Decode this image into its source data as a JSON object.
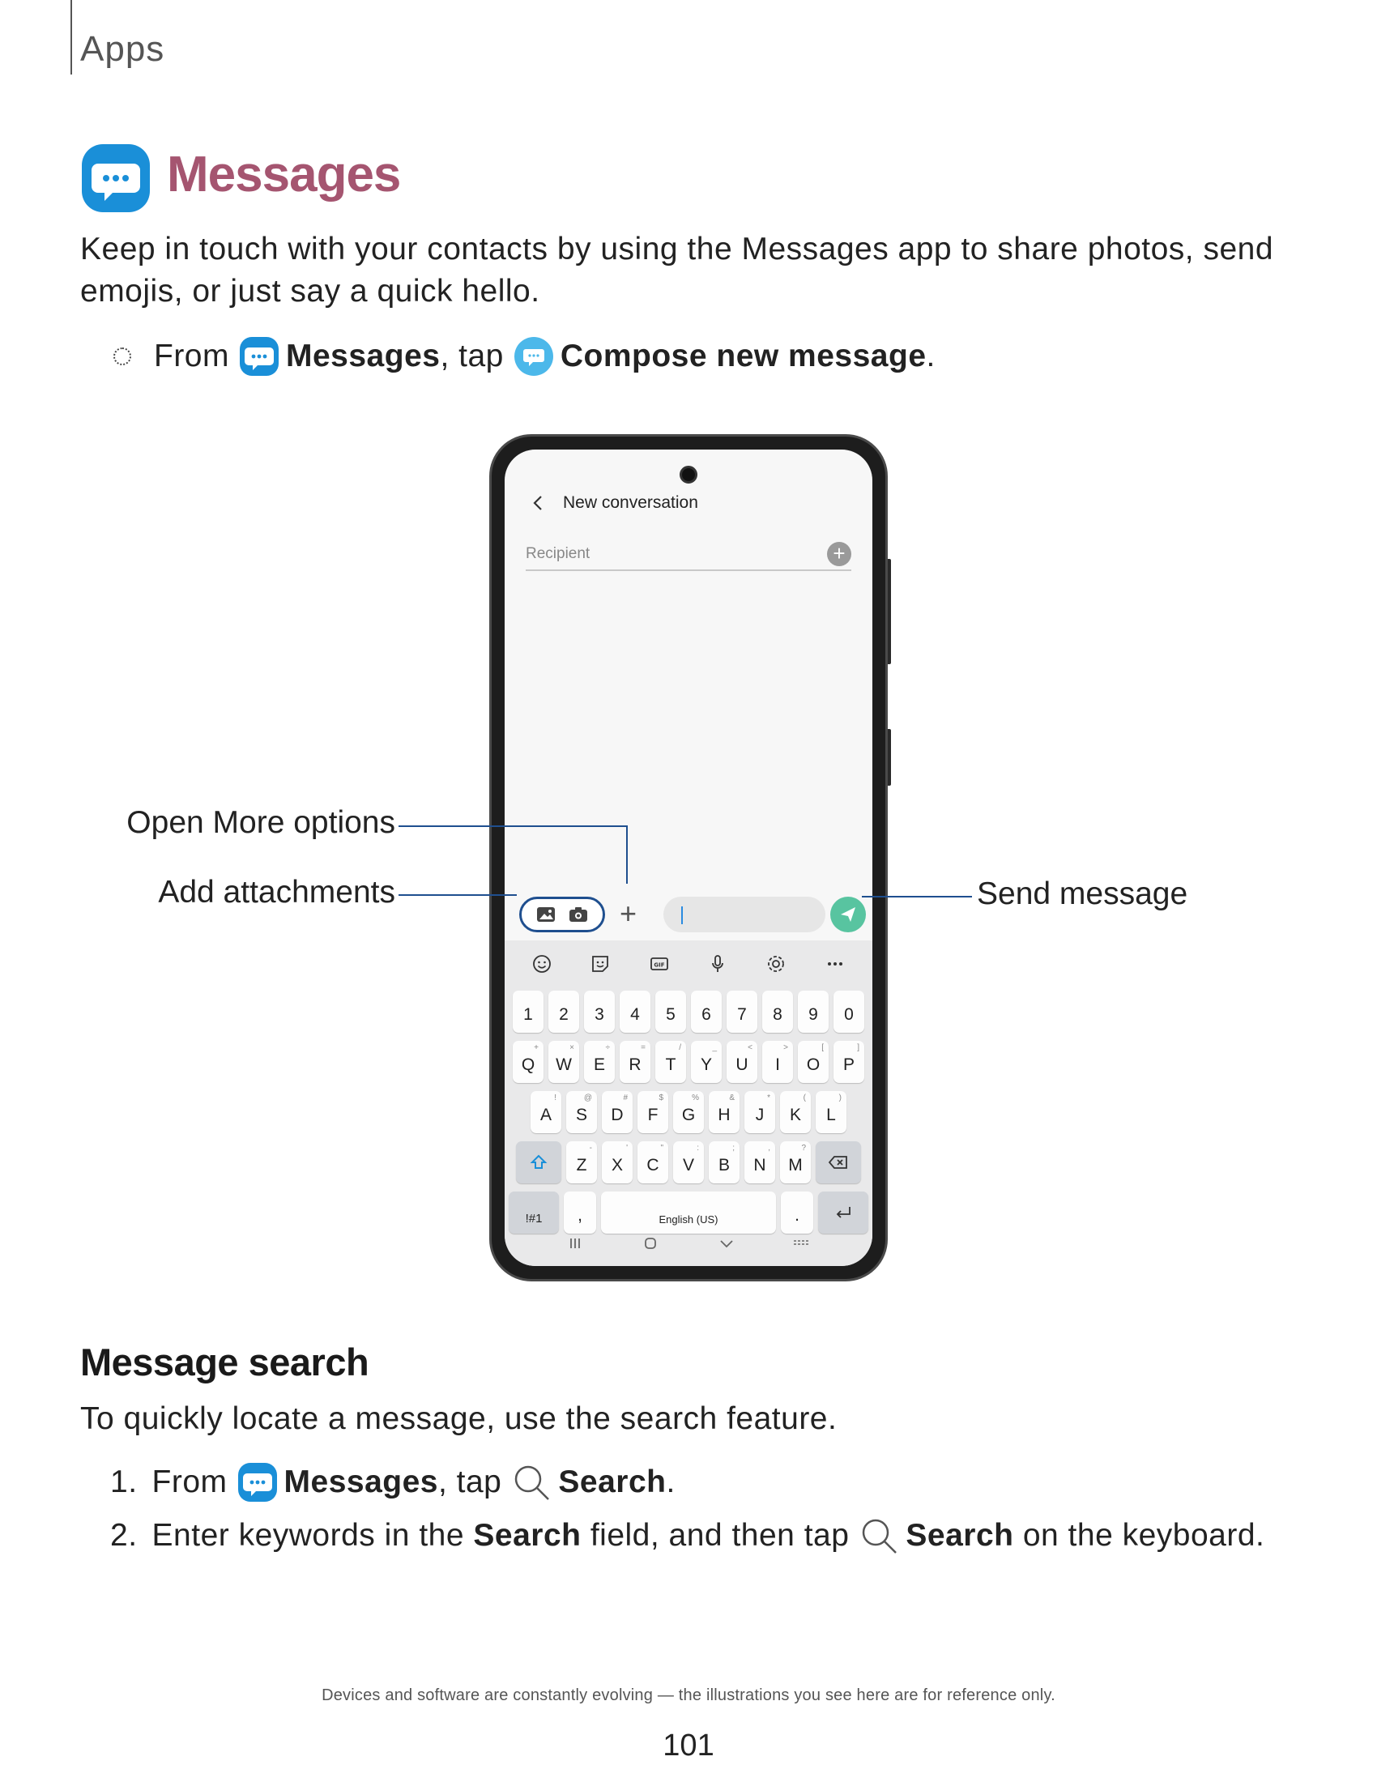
{
  "header": {
    "section_label": "Apps"
  },
  "title": "Messages",
  "intro": "Keep in touch with your contacts by using the Messages app to share photos, send emojis, or just say a quick hello.",
  "bullet": {
    "from": "From",
    "app_name": "Messages",
    "tap": ", tap",
    "action": "Compose new message",
    "end": "."
  },
  "phone": {
    "conversation_title": "New conversation",
    "recipient_placeholder": "Recipient",
    "keyboard": {
      "number_row": [
        "1",
        "2",
        "3",
        "4",
        "5",
        "6",
        "7",
        "8",
        "9",
        "0"
      ],
      "row1": [
        [
          "Q",
          "+"
        ],
        [
          "W",
          "×"
        ],
        [
          "E",
          "÷"
        ],
        [
          "R",
          "="
        ],
        [
          "T",
          "/"
        ],
        [
          "Y",
          "_"
        ],
        [
          "U",
          "<"
        ],
        [
          "I",
          ">"
        ],
        [
          "O",
          "["
        ],
        [
          "P",
          "]"
        ]
      ],
      "row2": [
        [
          "A",
          "!"
        ],
        [
          "S",
          "@"
        ],
        [
          "D",
          "#"
        ],
        [
          "F",
          "$"
        ],
        [
          "G",
          "%"
        ],
        [
          "H",
          "&"
        ],
        [
          "J",
          "*"
        ],
        [
          "K",
          "("
        ],
        [
          "L",
          ")"
        ]
      ],
      "row3": [
        [
          "Z",
          "-"
        ],
        [
          "X",
          "'"
        ],
        [
          "C",
          "\""
        ],
        [
          "V",
          ":"
        ],
        [
          "B",
          ";"
        ],
        [
          "N",
          ","
        ],
        [
          "M",
          "?"
        ]
      ],
      "symbols_key": "!#1",
      "comma_key": ",",
      "space_label": "English (US)",
      "period_key": ".",
      "gif_label": "GIF"
    }
  },
  "callouts": {
    "more_options": "Open More options",
    "attachments": "Add attachments",
    "send": "Send message"
  },
  "search_section": {
    "heading": "Message search",
    "intro": "To quickly locate a message, use the search feature.",
    "step1": {
      "num": "1.",
      "from": "From",
      "app_name": "Messages",
      "tap": ", tap",
      "action": "Search",
      "end": "."
    },
    "step2": {
      "num": "2.",
      "a": "Enter keywords in the",
      "field": "Search",
      "b": "field, and then tap",
      "action": "Search",
      "c": "on the keyboard."
    }
  },
  "footer": {
    "note": "Devices and software are constantly evolving — the illustrations you see here are for reference only.",
    "page_number": "101"
  },
  "colors": {
    "title": "#a55570",
    "app_icon": "#1a8fd8",
    "compose_icon": "#4cb8ea",
    "callout": "#1f4f8f",
    "send_button": "#58c4a0"
  }
}
